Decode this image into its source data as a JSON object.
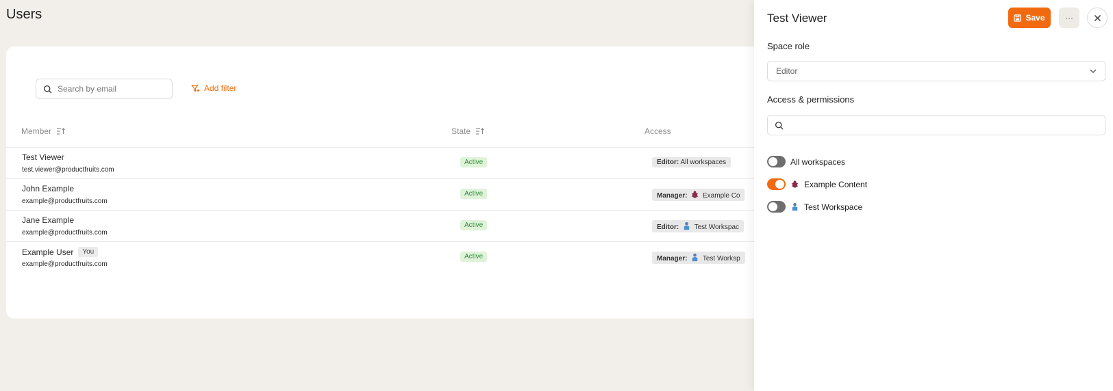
{
  "page": {
    "title": "Users"
  },
  "toolbar": {
    "search_placeholder": "Search by email",
    "add_filter_label": "Add filter"
  },
  "table": {
    "columns": {
      "member": "Member",
      "state": "State",
      "access": "Access"
    },
    "rows": [
      {
        "name": "Test Viewer",
        "email": "test.viewer@productfruits.com",
        "you": "",
        "state": "Active",
        "access_role": "Editor:",
        "access_scope": "All workspaces",
        "scope_icon": ""
      },
      {
        "name": "John Example",
        "email": "example@productfruits.com",
        "you": "",
        "state": "Active",
        "access_role": "Manager:",
        "access_scope": "Example Co",
        "scope_icon": "bug-icon"
      },
      {
        "name": "Jane Example",
        "email": "example@productfruits.com",
        "you": "",
        "state": "Active",
        "access_role": "Editor:",
        "access_scope": "Test Workspac",
        "scope_icon": "person-icon"
      },
      {
        "name": "Example User",
        "email": "example@productfruits.com",
        "you": "You",
        "state": "Active",
        "access_role": "Manager:",
        "access_scope": "Test Worksp",
        "scope_icon": "person-icon"
      }
    ]
  },
  "panel": {
    "title": "Test Viewer",
    "save_label": "Save",
    "more_label": "···",
    "space_role_label": "Space role",
    "space_role_value": "Editor",
    "access_label": "Access & permissions",
    "toggles": [
      {
        "label": "All workspaces",
        "on": false,
        "icon": ""
      },
      {
        "label": "Example Content",
        "on": true,
        "icon": "bug-icon"
      },
      {
        "label": "Test Workspace",
        "on": false,
        "icon": "person-icon"
      }
    ]
  },
  "colors": {
    "accent": "#f26a0f",
    "background": "#f2efea",
    "active_badge_bg": "#dff3d9",
    "active_badge_text": "#2f8a3a"
  }
}
